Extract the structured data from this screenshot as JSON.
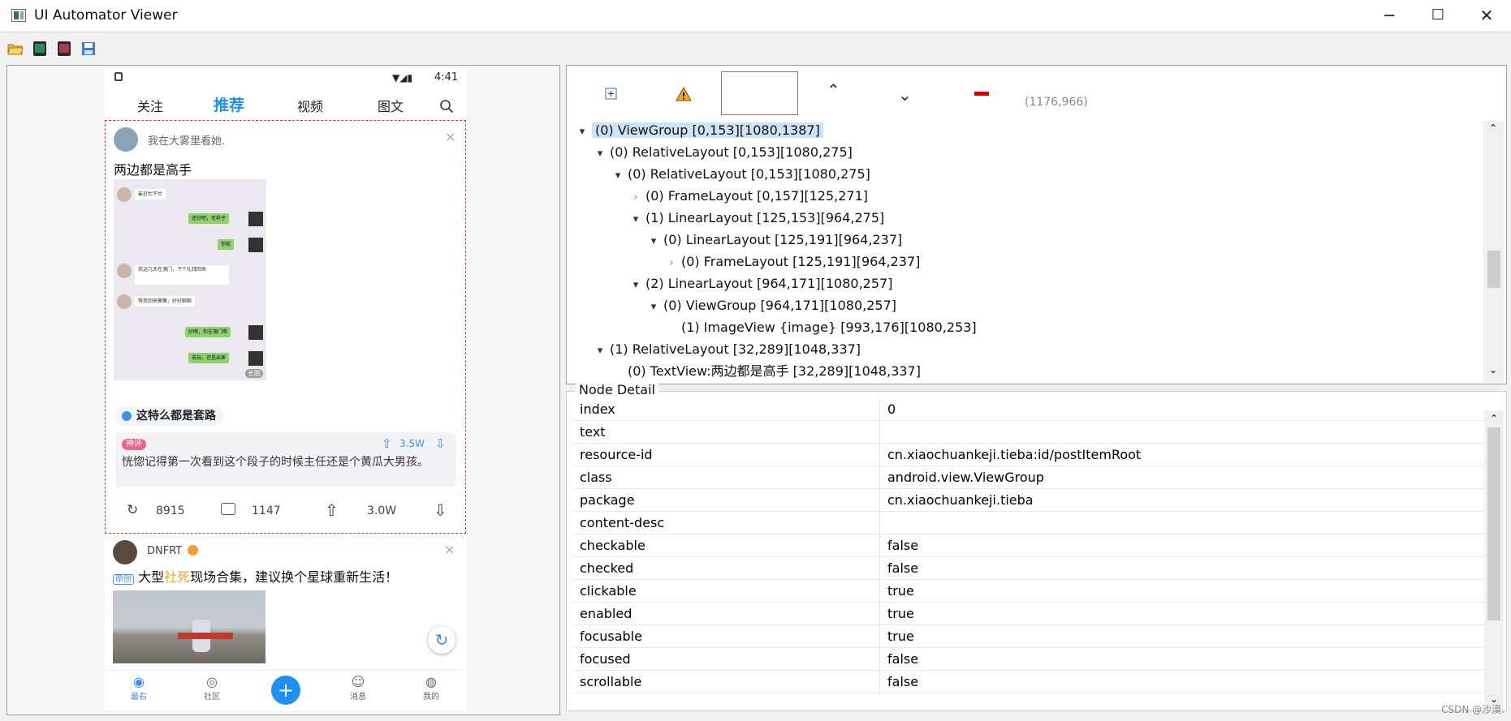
{
  "window": {
    "title": "UI Automator Viewer",
    "minimize": "─",
    "maximize": "☐",
    "close": "✕"
  },
  "toolbar": {
    "icons": [
      "open-folder-icon",
      "device-screenshot-icon",
      "device-screenshot-compressed-icon",
      "save-icon"
    ]
  },
  "phone": {
    "status_time": "4:41",
    "tabs": [
      "关注",
      "推荐",
      "视频",
      "图文"
    ],
    "active_tab": "推荐",
    "post1": {
      "author_line": "我在大雾里看她.",
      "title": "两边都是高手",
      "chat": [
        "最近忙不忙",
        "还好吧，老样子",
        "你呢",
        "我这几天在澳门，下个礼拜回来",
        "等我回来聚聚，好好聊聊",
        "好啊，你在澳门啊",
        "去玩，还是出差"
      ],
      "image_badge": "长图",
      "topic": "这特么都是套路",
      "god_comment_badge": "神评",
      "comment_text": "恍惚记得第一次看到这个段子的时候主任还是个黄瓜大男孩。",
      "comment_likes": "3.5W",
      "shares": "8915",
      "comments": "1147",
      "likes": "3.0W"
    },
    "post2": {
      "author": "DNFRT",
      "badge": "原创",
      "title_pre": "大型",
      "title_highlight": "社死",
      "title_post": "现场合集，建议换个星球重新生活！"
    },
    "nav": [
      "最右",
      "社区",
      "",
      "消息",
      "我的"
    ]
  },
  "tree_toolbar": {
    "coords": "(1176,966)"
  },
  "tree": [
    {
      "depth": 0,
      "arrow": "down",
      "label": "(0) ViewGroup [0,153][1080,1387]",
      "selected": true
    },
    {
      "depth": 1,
      "arrow": "down",
      "label": "(0) RelativeLayout [0,153][1080,275]"
    },
    {
      "depth": 2,
      "arrow": "down",
      "label": "(0) RelativeLayout [0,153][1080,275]"
    },
    {
      "depth": 3,
      "arrow": "right",
      "label": "(0) FrameLayout [0,157][125,271]"
    },
    {
      "depth": 3,
      "arrow": "down",
      "label": "(1) LinearLayout [125,153][964,275]"
    },
    {
      "depth": 4,
      "arrow": "down",
      "label": "(0) LinearLayout [125,191][964,237]"
    },
    {
      "depth": 5,
      "arrow": "right",
      "label": "(0) FrameLayout [125,191][964,237]"
    },
    {
      "depth": 3,
      "arrow": "down",
      "label": "(2) LinearLayout [964,171][1080,257]"
    },
    {
      "depth": 4,
      "arrow": "down",
      "label": "(0) ViewGroup [964,171][1080,257]"
    },
    {
      "depth": 5,
      "arrow": "none",
      "label": "(1) ImageView {image} [993,176][1080,253]"
    },
    {
      "depth": 1,
      "arrow": "down",
      "label": "(1) RelativeLayout [32,289][1048,337]"
    },
    {
      "depth": 2,
      "arrow": "none",
      "label": "(0) TextView:两边都是高手 [32,289][1048,337]"
    }
  ],
  "detail": {
    "legend": "Node Detail",
    "rows": [
      {
        "k": "index",
        "v": "0"
      },
      {
        "k": "text",
        "v": ""
      },
      {
        "k": "resource-id",
        "v": "cn.xiaochuankeji.tieba:id/postItemRoot"
      },
      {
        "k": "class",
        "v": "android.view.ViewGroup"
      },
      {
        "k": "package",
        "v": "cn.xiaochuankeji.tieba"
      },
      {
        "k": "content-desc",
        "v": ""
      },
      {
        "k": "checkable",
        "v": "false"
      },
      {
        "k": "checked",
        "v": "false"
      },
      {
        "k": "clickable",
        "v": "true"
      },
      {
        "k": "enabled",
        "v": "true"
      },
      {
        "k": "focusable",
        "v": "true"
      },
      {
        "k": "focused",
        "v": "false"
      },
      {
        "k": "scrollable",
        "v": "false"
      }
    ]
  },
  "watermark": "CSDN @沙漠."
}
